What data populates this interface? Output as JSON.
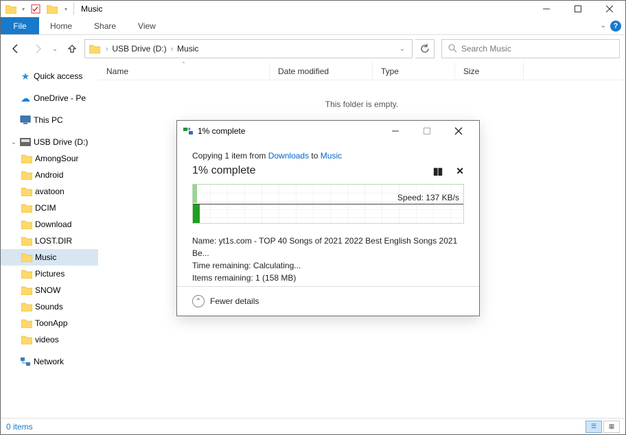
{
  "titlebar": {
    "title": "Music"
  },
  "ribbon": {
    "file": "File",
    "home": "Home",
    "share": "Share",
    "view": "View"
  },
  "breadcrumb": {
    "root": "",
    "drive": "USB Drive (D:)",
    "folder": "Music"
  },
  "search": {
    "placeholder": "Search Music"
  },
  "columns": {
    "name": "Name",
    "date": "Date modified",
    "type": "Type",
    "size": "Size"
  },
  "empty": "This folder is empty.",
  "nav": {
    "quick": "Quick access",
    "onedrive": "OneDrive - Pe",
    "thispc": "This PC",
    "usb": "USB Drive (D:)",
    "items": [
      "AmongSour",
      "Android",
      "avatoon",
      "DCIM",
      "Download",
      "LOST.DIR",
      "Music",
      "Pictures",
      "SNOW",
      "Sounds",
      "ToonApp",
      "videos"
    ],
    "network": "Network"
  },
  "status": {
    "items": "0 items"
  },
  "dialog": {
    "title": "1% complete",
    "copying_prefix": "Copying 1 item from ",
    "src": "Downloads",
    "to": " to ",
    "dst": "Music",
    "percent": "1% complete",
    "speed": "Speed: 137 KB/s",
    "name": "Name:  yt1s.com - TOP 40 Songs of 2021 2022  Best English Songs 2021 Be...",
    "time": "Time remaining:  Calculating...",
    "remaining": "Items remaining:  1 (158 MB)",
    "fewer": "Fewer details"
  }
}
